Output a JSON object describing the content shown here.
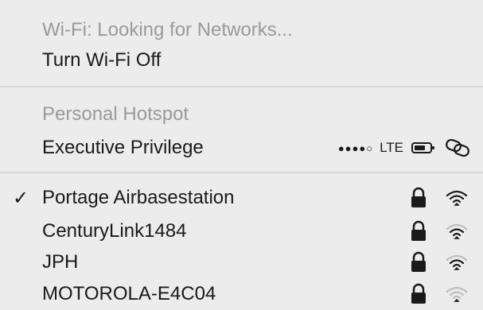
{
  "wifi": {
    "status": "Wi-Fi: Looking for Networks...",
    "toggle_label": "Turn Wi-Fi Off"
  },
  "hotspot": {
    "section_label": "Personal Hotspot",
    "device_name": "Executive Privilege",
    "signal_dots": "●●●●○",
    "network_type": "LTE"
  },
  "networks": [
    {
      "name": "Portage Airbasestation",
      "connected": true,
      "checkmark": "✓",
      "locked": true,
      "signal": 1.0
    },
    {
      "name": "CenturyLink1484",
      "connected": false,
      "locked": true,
      "signal": 0.75
    },
    {
      "name": "JPH",
      "connected": false,
      "locked": true,
      "signal": 0.75
    },
    {
      "name": "MOTOROLA-E4C04",
      "connected": false,
      "locked": true,
      "signal": 0.25
    }
  ],
  "icons": {
    "lock": "lock-icon",
    "wifi": "wifi-signal-icon",
    "battery": "battery-icon",
    "link": "link-icon"
  }
}
